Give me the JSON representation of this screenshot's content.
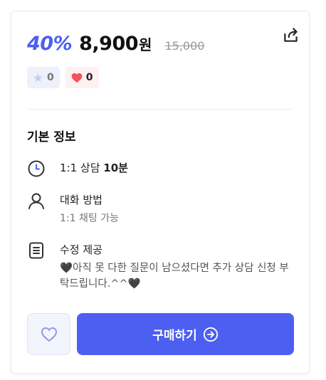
{
  "pricing": {
    "discount": "40%",
    "price": "8,900",
    "currency": "원",
    "original_price": "15,000"
  },
  "stats": {
    "rating_count": "0",
    "like_count": "0"
  },
  "section_title": "기본 정보",
  "info": {
    "consult_prefix": "1:1 상담 ",
    "consult_duration": "10분",
    "method_title": "대화 방법",
    "method_detail": "1:1 채팅 가능",
    "revision_title": "수정 제공",
    "revision_detail": "🖤아직 못 다한 질문이 남으셨다면 추가 상담 신청 부탁드립니다.^^🖤"
  },
  "buttons": {
    "buy_label": "구매하기"
  },
  "colors": {
    "accent": "#4c5ff0",
    "heart": "#f0545f"
  }
}
